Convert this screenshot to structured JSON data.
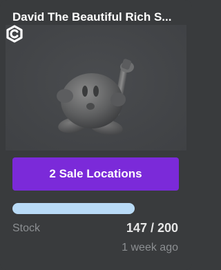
{
  "item": {
    "title": "David The Beautiful Rich S...",
    "thumbnail_icon": "gray-3d-figure-icon",
    "creator_badge_icon": "creator-logo-icon"
  },
  "actions": {
    "sale_button_label": "2 Sale Locations"
  },
  "stock": {
    "label": "Stock",
    "value_text": "147 / 200",
    "sold": 147,
    "total": 200,
    "progress_fraction": 0.735
  },
  "meta": {
    "timestamp": "1 week ago"
  },
  "colors": {
    "card_bg": "#393b3d",
    "button_bg": "#7b2ad9",
    "progress_fill": "#b9dbf7",
    "muted_text": "#8c8f92"
  }
}
